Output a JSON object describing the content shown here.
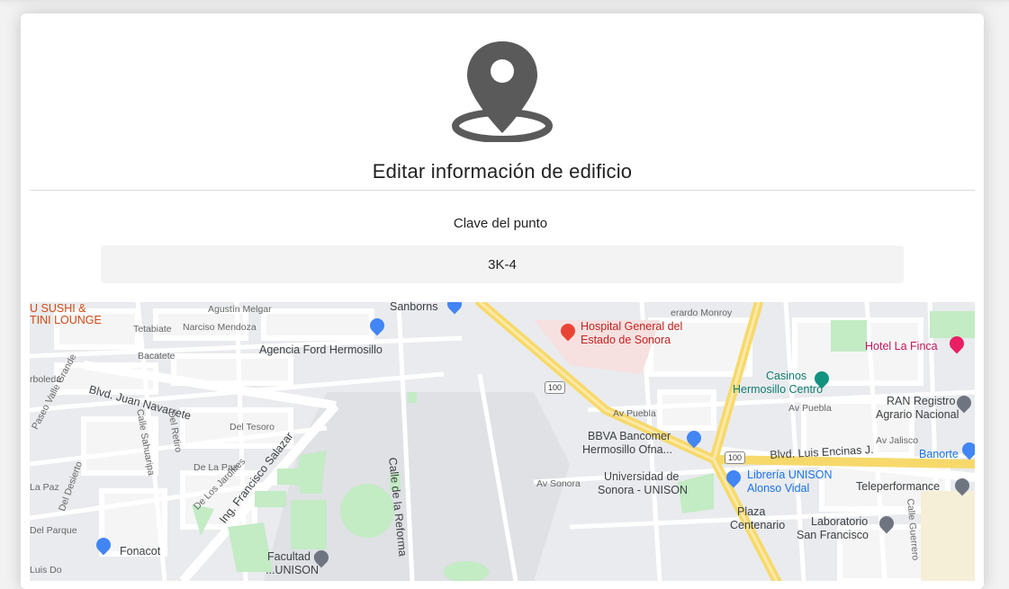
{
  "page": {
    "title": "Editar información de edificio",
    "icon": "map-marker-icon"
  },
  "form": {
    "point_key_label": "Clave del punto",
    "point_key_value": "3K-4"
  },
  "map": {
    "labels": {
      "sushi_line1": "U SUSHI &",
      "sushi_line2": "TINI LOUNGE",
      "melgar": "Agustín Melgar",
      "sanborns": "Sanborns",
      "gerardo_monroy": "erardo Monroy",
      "tetabiate": "Tetabiate",
      "narciso": "Narciso Mendoza",
      "hospital_line1": "Hospital General del",
      "hospital_line2": "Estado de Sonora",
      "hotel_la_finca": "Hotel La Finca",
      "bacatete": "Bacatete",
      "agencia_ford": "Agencia Ford Hermosillo",
      "casinos_line1": "Casinos",
      "casinos_line2": "Hermosillo Centro",
      "arboleda": "rboleda",
      "juan_navarrete": "Blvd. Juan Navarrete",
      "paseo_valle": "Paseo Valle Grande",
      "ran_line1": "RAN Registro",
      "ran_line2": "Agrario Nacional",
      "calle_sahuaripa": "Calle Sahuaripa",
      "del_retiro": "Del Retiro",
      "del_tesoro": "Del Tesoro",
      "av_puebla": "Av Puebla",
      "av_puebla2": "Av Puebla",
      "bbva_line1": "BBVA Bancomer",
      "bbva_line2": "Hermosillo Ofna...",
      "av_jalisco": "Av Jalisco",
      "banorte": "Banorte",
      "luis_encinas": "Blvd. Luis Encinas J.",
      "la_paz": "La Paz",
      "de_la_paz": "De La Paz",
      "de_los_jardines": "De Los Jardines",
      "francisco_salazar": "Ing. Francisco Salazar",
      "calle_reforma": "Calle de la Reforma",
      "unison_line1": "Universidad de",
      "unison_line2": "Sonora - UNISON",
      "av_sonora": "Av Sonora",
      "libreria_line1": "Librería UNISON",
      "libreria_line2": "Alonso Vidal",
      "teleperformance": "Teleperformance",
      "del_desierto": "Del Desierto",
      "del_parque": "Del Parque",
      "calle_guerrero": "Calle Guerrero",
      "plaza_line1": "Plaza",
      "plaza_line2": "Centenario",
      "lab_line1": "Laboratorio",
      "lab_line2": "San Francisco",
      "fonacot": "Fonacot",
      "luis_do": "Luis Do",
      "facultad_line1": "Facultad de",
      "facultad_line2": "...UNISON",
      "highway": "100"
    }
  }
}
